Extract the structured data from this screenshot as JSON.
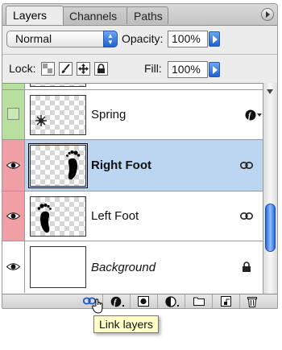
{
  "tabs": [
    {
      "label": "Layers",
      "active": true
    },
    {
      "label": "Channels",
      "active": false
    },
    {
      "label": "Paths",
      "active": false
    }
  ],
  "options": {
    "blend_mode": "Normal",
    "opacity_label": "Opacity:",
    "opacity_value": "100%",
    "lock_label": "Lock:",
    "fill_label": "Fill:",
    "fill_value": "100%"
  },
  "layers": [
    {
      "name": "",
      "color_tag": "green",
      "visible": false,
      "partial": true
    },
    {
      "name": "Spring",
      "color_tag": "green",
      "visible": false,
      "icon": "layer-effects-icon"
    },
    {
      "name": "Right Foot",
      "color_tag": "red",
      "visible": true,
      "selected": true,
      "icon": "link-icon"
    },
    {
      "name": "Left Foot",
      "color_tag": "red",
      "visible": true,
      "icon": "link-icon"
    },
    {
      "name": "Background",
      "color_tag": "none",
      "visible": true,
      "icon": "lock-icon",
      "italic": true
    }
  ],
  "toolbar": {
    "buttons": [
      "link-layers",
      "layer-style",
      "layer-mask",
      "adjustment-layer",
      "new-group",
      "new-layer",
      "delete-layer"
    ]
  },
  "tooltip": "Link layers",
  "colors": {
    "selection": "#bcd5f1",
    "tag_green": "#b9df9f",
    "tag_red": "#f0a0a4",
    "aqua_blue": "#1f62d4"
  }
}
